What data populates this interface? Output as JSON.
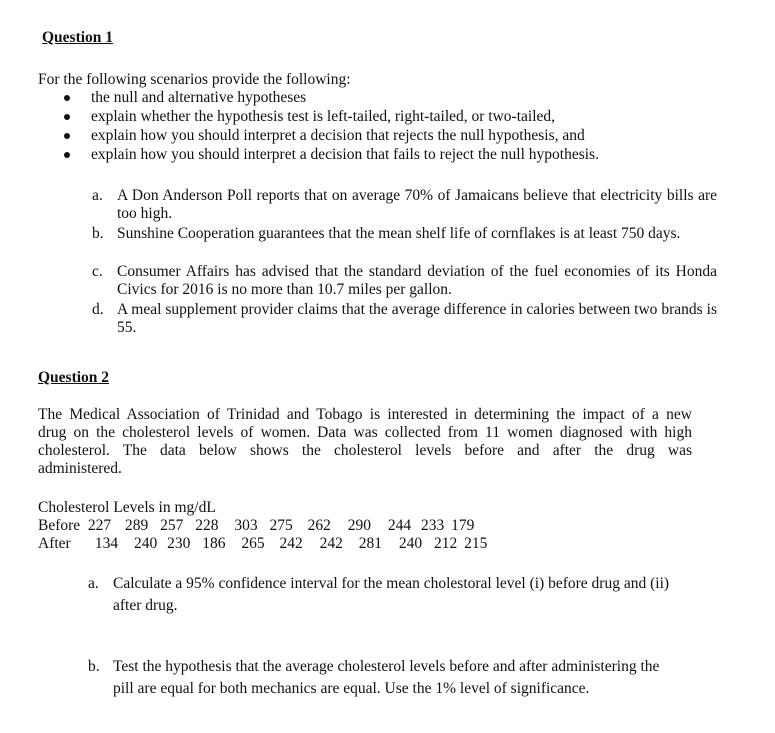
{
  "question1": {
    "heading": "Question 1",
    "intro": "For the following scenarios provide the following:",
    "bullets": [
      "the null and alternative hypotheses",
      "explain whether the hypothesis test is left-tailed, right-tailed, or two-tailed,",
      "explain how you should interpret a decision that rejects the null hypothesis, and",
      "explain how you should interpret a decision that fails to reject the null hypothesis."
    ],
    "items": [
      {
        "label": "a.",
        "text": "A Don Anderson Poll reports that on average 70% of Jamaicans believe that electricity bills are too high."
      },
      {
        "label": "b.",
        "text": "Sunshine Cooperation guarantees that the mean shelf life of cornflakes is at least 750 days."
      },
      {
        "label": "c.",
        "text": "Consumer Affairs has advised that the standard deviation of the fuel economies of its Honda Civics for 2016 is no more than 10.7 miles per gallon."
      },
      {
        "label": "d.",
        "text": "A meal supplement provider claims that the average difference in calories between two brands is 55."
      }
    ]
  },
  "question2": {
    "heading": "Question 2",
    "paragraph_lines": [
      "The Medical Association of Trinidad and Tobago is interested in determining the impact of a new",
      "drug on the cholesterol levels of women. Data was collected from 11 women diagnosed with high",
      "cholesterol. The data below shows the cholesterol levels before and after the drug was",
      "administered."
    ],
    "table_title": "Cholesterol Levels in mg/dL",
    "rows": [
      {
        "label": "Before",
        "values": [
          "227",
          "289",
          "257",
          "228",
          "303",
          "275",
          "262",
          "290",
          "244",
          "233",
          "179"
        ]
      },
      {
        "label": "After",
        "values": [
          "134",
          "240",
          "230",
          "186",
          "265",
          "242",
          "242",
          "281",
          "240",
          "212",
          "215"
        ]
      }
    ],
    "items": [
      {
        "label": "a.",
        "text": "Calculate a 95% confidence interval for the mean cholestoral level  (i) before drug and (ii) after drug."
      },
      {
        "label": "b.",
        "text": "Test the hypothesis that the average cholesterol levels before and after administering the pill are equal for both mechanics are equal. Use the 1% level of significance."
      }
    ]
  }
}
